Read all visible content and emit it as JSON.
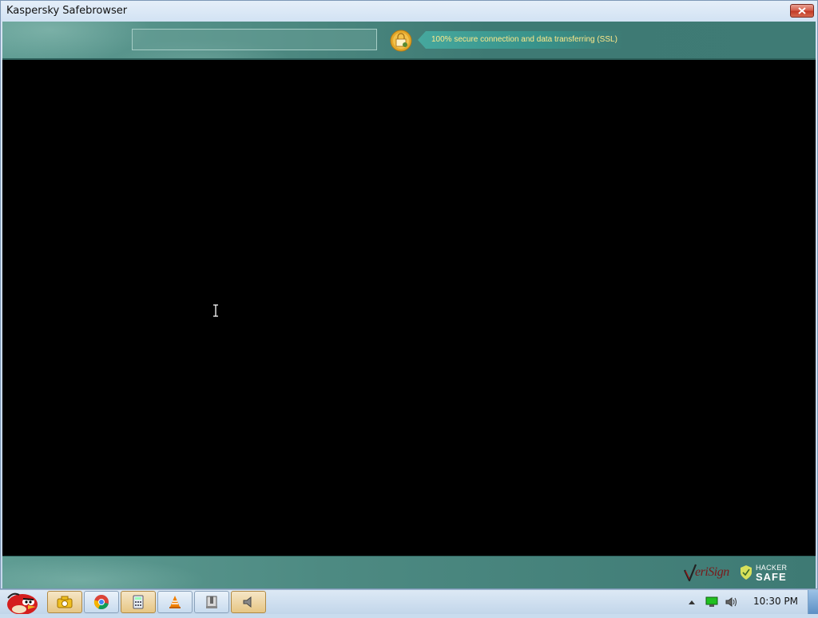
{
  "window": {
    "title": "Kaspersky Safebrowser",
    "close_label": "Close"
  },
  "toolbar": {
    "address_value": "",
    "ssl_text": "100% secure connection and data transferring (SSL)"
  },
  "footer": {
    "verisign_text": "eriSign",
    "hackersafe_line1": "HACKER",
    "hackersafe_line2": "SAFE"
  },
  "taskbar": {
    "clock": "10:30 PM",
    "apps": [
      {
        "name": "angry-birds-start",
        "icon": "red-bird-icon"
      },
      {
        "name": "camera-app",
        "icon": "camera-icon"
      },
      {
        "name": "chrome",
        "icon": "chrome-icon"
      },
      {
        "name": "calculator",
        "icon": "calculator-icon"
      },
      {
        "name": "vlc",
        "icon": "vlc-cone-icon"
      },
      {
        "name": "archive-manager",
        "icon": "archive-icon"
      },
      {
        "name": "audio-app",
        "icon": "speaker-icon"
      }
    ]
  },
  "colors": {
    "toolbar_teal": "#4f8b83",
    "ssl_text_color": "#ffe98a",
    "content_bg": "#000000"
  }
}
